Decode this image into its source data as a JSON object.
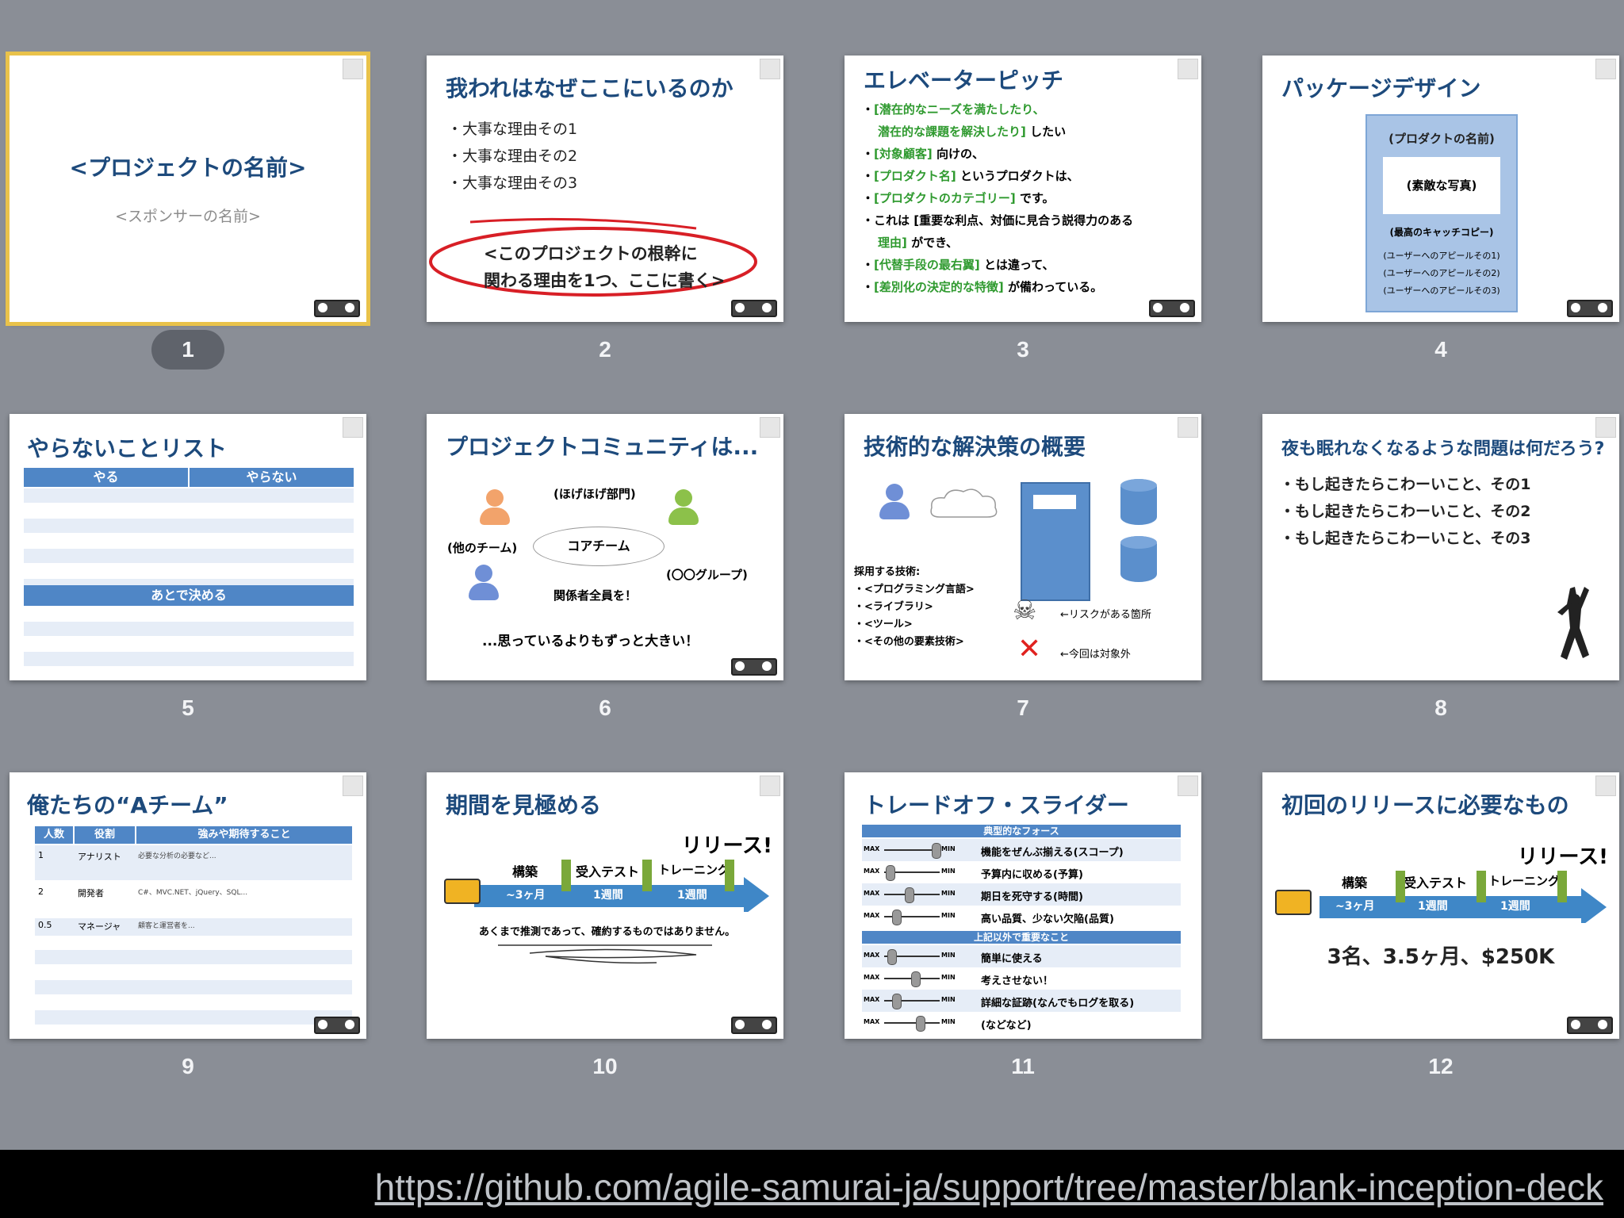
{
  "slides": [
    {
      "number": "1",
      "title": "<プロジェクトの名前>",
      "subtitle": "<スポンサーの名前>"
    },
    {
      "number": "2",
      "title": "我われはなぜここにいるのか",
      "bullets": [
        "大事な理由その1",
        "大事な理由その2",
        "大事な理由その3"
      ],
      "callout": [
        "<このプロジェクトの根幹に",
        "関わる理由を1つ、ここに書く>"
      ]
    },
    {
      "number": "3",
      "title": "エレベーターピッチ",
      "lines": [
        {
          "green": "[潜在的なニーズを満たしたり、",
          "black": ""
        },
        {
          "green": "潜在的な課題を解決したり]",
          "black": " したい"
        },
        {
          "green": "[対象顧客]",
          "black": " 向けの、"
        },
        {
          "green": "[プロダクト名]",
          "black": " というプロダクトは、"
        },
        {
          "green": "[プロダクトのカテゴリー]",
          "black": " です。"
        },
        {
          "green": "",
          "black": "これは [重要な利点、対価に見合う説得力のある"
        },
        {
          "green": "理由]",
          "black": " ができ、"
        },
        {
          "green": "[代替手段の最右翼]",
          "black": " とは違って、"
        },
        {
          "green": "[差別化の決定的な特徴]",
          "black": " が備わっている。"
        }
      ]
    },
    {
      "number": "4",
      "title": "パッケージデザイン",
      "box_title": "(プロダクトの名前)",
      "photo": "(素敵な写真)",
      "copy": "(最高のキャッチコピー)",
      "appeals": [
        "(ユーザーへのアピールその1)",
        "(ユーザーへのアピールその2)",
        "(ユーザーへのアピールその3)"
      ]
    },
    {
      "number": "5",
      "title": "やらないことリスト",
      "col_do": "やる",
      "col_dont": "やらない",
      "later": "あとで決める"
    },
    {
      "number": "6",
      "title": "プロジェクトコミュニティは...",
      "groups": {
        "hoge": "(ほげほげ部門)",
        "other": "(他のチーム)",
        "core": "コアチーム",
        "group": "(〇〇グループ)",
        "all": "関係者全員を！"
      },
      "footer": "...思っているよりもずっと大きい！"
    },
    {
      "number": "7",
      "title": "技術的な解決策の概要",
      "tech_title": "採用する技術:",
      "tech": [
        "・<プログラミング言語>",
        "・<ライブラリ>",
        "・<ツール>",
        "・<その他の要素技術>"
      ],
      "risk": "←リスクがある箇所",
      "out": "←今回は対象外"
    },
    {
      "number": "8",
      "title": "夜も眠れなくなるような問題は何だろう?",
      "bullets": [
        "もし起きたらこわーいこと、その1",
        "もし起きたらこわーいこと、その2",
        "もし起きたらこわーいこと、その3"
      ]
    },
    {
      "number": "9",
      "title": "俺たちの“Aチーム”",
      "headers": [
        "人数",
        "役割",
        "強みや期待すること"
      ],
      "rows": [
        {
          "n": "1",
          "role": "アナリスト",
          "desc": "必要な分析の必要など..."
        },
        {
          "n": "2",
          "role": "開発者",
          "desc": "C#、MVC.NET、jQuery、SQL..."
        },
        {
          "n": "0.5",
          "role": "マネージャ",
          "desc": "顧客と運営者を..."
        }
      ]
    },
    {
      "number": "10",
      "title": "期間を見極める",
      "release": "リリース!",
      "phases": [
        "構築",
        "受入テスト",
        "トレーニング"
      ],
      "durations": [
        "~3ヶ月",
        "1週間",
        "1週間"
      ],
      "note": "あくまで推測であって、確約するものではありません。"
    },
    {
      "number": "11",
      "title": "トレードオフ・スライダー",
      "section1": "典型的なフォース",
      "section2": "上記以外で重要なこと",
      "forces": [
        "機能をぜんぶ揃える(スコープ)",
        "予算内に収める(予算)",
        "期日を死守する(時間)",
        "高い品質、少ない欠陥(品質)"
      ],
      "others": [
        "簡単に使える",
        "考えさせない！",
        "詳細な証跡(なんでもログを取る)",
        "(などなど)"
      ],
      "max": "MAX",
      "min": "MIN"
    },
    {
      "number": "12",
      "title": "初回のリリースに必要なもの",
      "release": "リリース!",
      "phases": [
        "構築",
        "受入テスト",
        "トレーニング"
      ],
      "durations": [
        "~3ヶ月",
        "1週間",
        "1週間"
      ],
      "summary": "3名、3.5ヶ月、$250K"
    }
  ],
  "url": "https://github.com/agile-samurai-ja/support/tree/master/blank-inception-deck",
  "colors": {
    "title": "#1d4a7c",
    "accent": "#4f86c6",
    "selected": "#e9c24a",
    "background": "#8a8e96",
    "green": "#2f9a2f"
  }
}
